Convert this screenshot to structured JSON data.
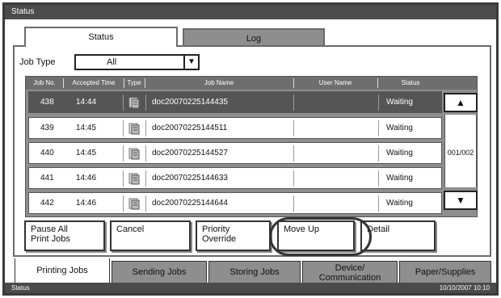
{
  "window": {
    "title": "Status"
  },
  "tabs": {
    "status": "Status",
    "log": "Log"
  },
  "job_type": {
    "label": "Job Type",
    "value": "All",
    "arrow": "▼"
  },
  "table": {
    "headers": {
      "job_no": "Job No.",
      "accepted_time": "Accepted Time",
      "type": "Type",
      "job_name": "Job Name",
      "user_name": "User Name",
      "status": "Status"
    },
    "rows": [
      {
        "job_no": "438",
        "time": "14:44",
        "name": "doc20070225144435",
        "user": "",
        "status": "Waiting"
      },
      {
        "job_no": "439",
        "time": "14:45",
        "name": "doc20070225144511",
        "user": "",
        "status": "Waiting"
      },
      {
        "job_no": "440",
        "time": "14:45",
        "name": "doc20070225144527",
        "user": "",
        "status": "Waiting"
      },
      {
        "job_no": "441",
        "time": "14:46",
        "name": "doc20070225144633",
        "user": "",
        "status": "Waiting"
      },
      {
        "job_no": "442",
        "time": "14:46",
        "name": "doc20070225144644",
        "user": "",
        "status": "Waiting"
      }
    ],
    "page_indicator": "001/002",
    "scroll_up": "▲",
    "scroll_down": "▼"
  },
  "actions": {
    "pause_all_line1": "Pause All",
    "pause_all_line2": "Print Jobs",
    "cancel": "Cancel",
    "priority_line1": "Priority",
    "priority_line2": "Override",
    "move_up": "Move Up",
    "detail": "Detail"
  },
  "bottom_tabs": {
    "printing": "Printing Jobs",
    "sending": "Sending Jobs",
    "storing": "Storing Jobs",
    "device_line1": "Device/",
    "device_line2": "Communication",
    "paper": "Paper/Supplies"
  },
  "status_bar": {
    "label": "Status",
    "datetime": "10/10/2007  10:10"
  }
}
